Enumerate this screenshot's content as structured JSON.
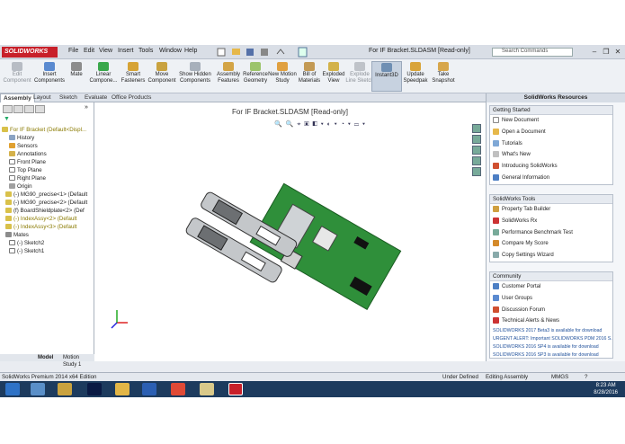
{
  "app": {
    "logo": "SOLIDWORKS",
    "menus": [
      "File",
      "Edit",
      "View",
      "Insert",
      "Tools",
      "Window",
      "Help"
    ],
    "document_title": "For IF Bracket.SLDASM [Read-only]",
    "search_placeholder": "Search Commands"
  },
  "ribbon": {
    "buttons": [
      {
        "label": "Edit Component",
        "dim": true
      },
      {
        "label": "Insert Components"
      },
      {
        "label": "Mate"
      },
      {
        "label": "Linear Compone..."
      },
      {
        "label": "Smart Fasteners"
      },
      {
        "label": "Move Component"
      },
      {
        "label": "Show Hidden Components"
      },
      {
        "label": "Assembly Features"
      },
      {
        "label": "Reference Geometry"
      },
      {
        "label": "New Motion Study"
      },
      {
        "label": "Bill of Materials"
      },
      {
        "label": "Exploded View"
      },
      {
        "label": "Explode Line Sketch",
        "dim": true
      },
      {
        "label": "Instant3D",
        "selected": true
      },
      {
        "label": "Update Speedpak"
      },
      {
        "label": "Take Snapshot"
      }
    ]
  },
  "tabs": [
    "Assembly",
    "Layout",
    "Sketch",
    "Evaluate",
    "Office Products"
  ],
  "active_tab": "Assembly",
  "feature_tree": {
    "items": [
      {
        "label": "For IF Bracket  (Default<Displ...",
        "indent": 0,
        "warn": true
      },
      {
        "label": "History",
        "indent": 1
      },
      {
        "label": "Sensors",
        "indent": 1
      },
      {
        "label": "Annotations",
        "indent": 1
      },
      {
        "label": "Front Plane",
        "indent": 1
      },
      {
        "label": "Top Plane",
        "indent": 1
      },
      {
        "label": "Right Plane",
        "indent": 1
      },
      {
        "label": "Origin",
        "indent": 1
      },
      {
        "label": "(-) MG90_precise<1> (Default",
        "indent": 1
      },
      {
        "label": "(-) MG90_precise<2> (Default",
        "indent": 1
      },
      {
        "label": "(f) BoardShieldplate<2> (Def",
        "indent": 1
      },
      {
        "label": "(-) IndexAssy<2> (Default",
        "indent": 1,
        "warn": true
      },
      {
        "label": "(-) IndexAssy<3> (Default",
        "indent": 1,
        "warn": true
      },
      {
        "label": "Mates",
        "indent": 1
      },
      {
        "label": "(-) Sketch2",
        "indent": 1
      },
      {
        "label": "(-) Sketch1",
        "indent": 1
      }
    ],
    "bottom_tabs": [
      "Model",
      "Motion Study 1"
    ]
  },
  "viewport": {
    "title": "For IF Bracket.SLDASM [Read-only]"
  },
  "task_pane": {
    "title": "SolidWorks Resources",
    "sections": [
      {
        "title": "Getting Started",
        "items": [
          "New Document",
          "Open a Document",
          "Tutorials",
          "What's New",
          "Introducing SolidWorks",
          "General Information"
        ]
      },
      {
        "title": "SolidWorks Tools",
        "items": [
          "Property Tab Builder",
          "SolidWorks Rx",
          "Performance Benchmark Test",
          "Compare My Score",
          "Copy Settings Wizard"
        ]
      },
      {
        "title": "Community",
        "items": [
          "Customer Portal",
          "User Groups",
          "Discussion Forum",
          "Technical Alerts & News"
        ],
        "news": [
          "SOLIDWORKS 2017 Beta3 is available for download",
          "URGENT ALERT: Important SOLIDWORKS PDM 2016 S...",
          "SOLIDWORKS 2016 SP4 is available for download",
          "SOLIDWORKS 2016 SP3 is available for download"
        ]
      }
    ]
  },
  "status_bar": {
    "left": "SolidWorks Premium 2014 x64 Edition",
    "under_defined": "Under Defined",
    "mode": "Editing Assembly",
    "units": "MMGS"
  },
  "taskbar": {
    "time": "8:23 AM",
    "date": "8/28/2016"
  },
  "colors": {
    "pcb": "#2f8f3a",
    "accent": "#c8202a"
  }
}
